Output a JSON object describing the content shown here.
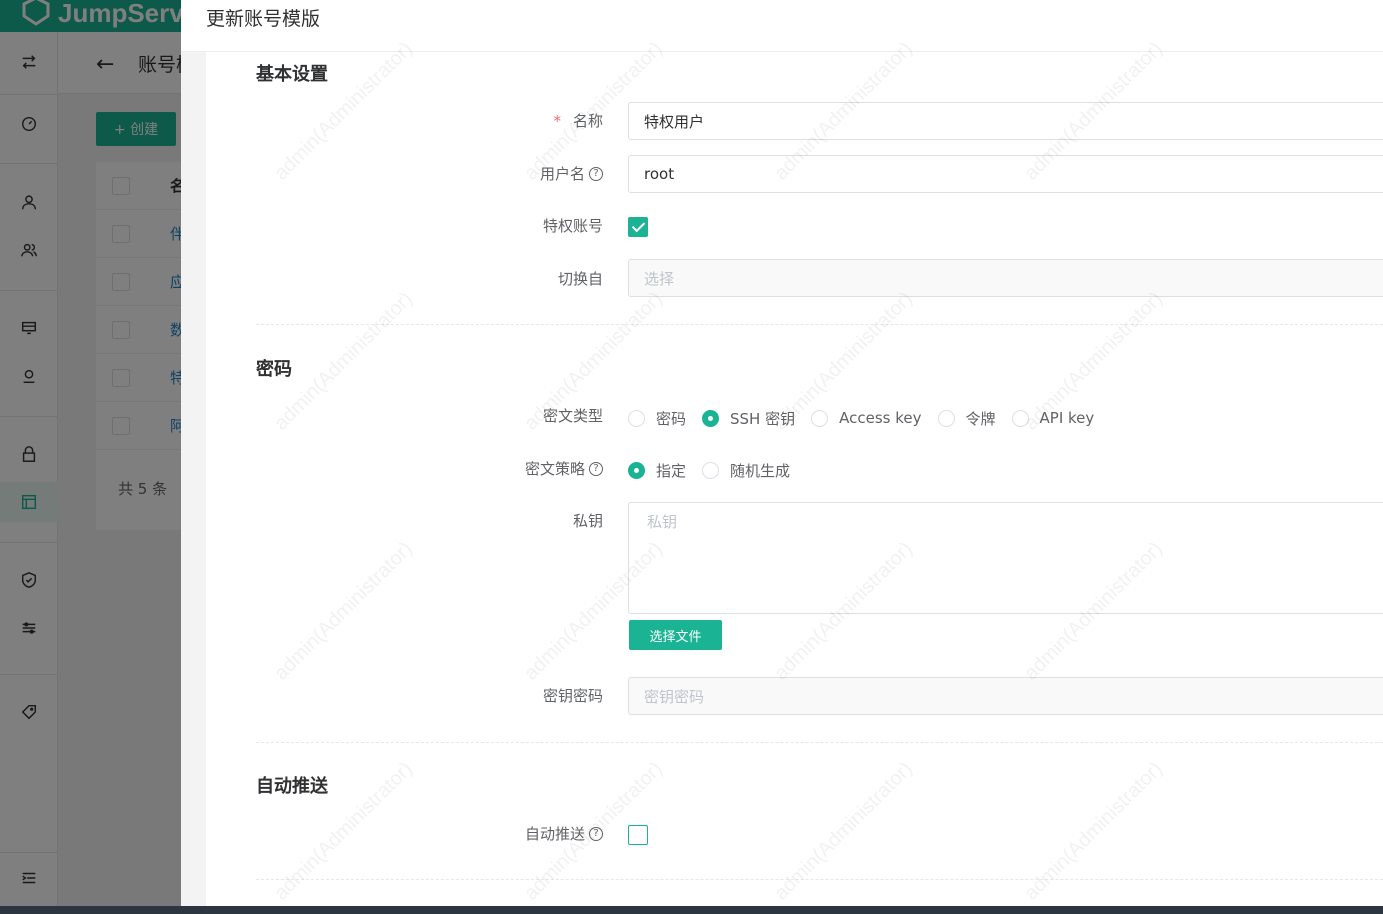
{
  "app": {
    "logo_text": "JumpServ",
    "page_title": "账号模",
    "create_button": "+ 创建",
    "table": {
      "header": "名",
      "rows": [
        "伴",
        "应",
        "数",
        "特",
        "阿"
      ]
    },
    "total_text": "共 5 条"
  },
  "drawer": {
    "title": "更新账号模版",
    "sections": {
      "basic": "基本设置",
      "password": "密码",
      "auto_push": "自动推送"
    },
    "fields": {
      "name": {
        "label": "名称",
        "required_mark": "*",
        "value": "特权用户"
      },
      "username": {
        "label": "用户名",
        "value": "root"
      },
      "privileged": {
        "label": "特权账号",
        "checked": true
      },
      "su_from": {
        "label": "切换自",
        "placeholder": "选择"
      },
      "secret_type": {
        "label": "密文类型",
        "options": [
          "密码",
          "SSH 密钥",
          "Access key",
          "令牌",
          "API key"
        ],
        "selected": "SSH 密钥"
      },
      "secret_strategy": {
        "label": "密文策略",
        "options": [
          "指定",
          "随机生成"
        ],
        "selected": "指定"
      },
      "private_key": {
        "label": "私钥",
        "placeholder": "私钥",
        "file_button": "选择文件"
      },
      "passphrase": {
        "label": "密钥密码",
        "placeholder": "密钥密码"
      },
      "auto_push": {
        "label": "自动推送",
        "checked": false
      }
    },
    "help_icon_glyph": "?"
  },
  "watermark_text": "admin(Administrator)",
  "colors": {
    "accent": "#1ab394",
    "link": "#1c84c6",
    "required": "#f56c6c"
  }
}
